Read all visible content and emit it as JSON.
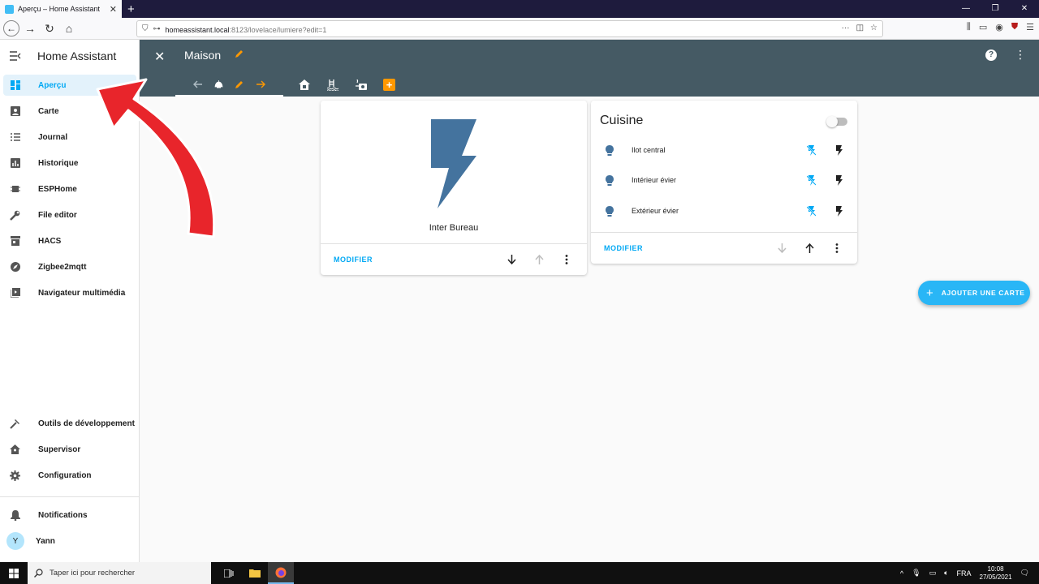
{
  "browser": {
    "tab_title": "Aperçu – Home Assistant",
    "new_tab": "+",
    "url_host": "homeassistant.local",
    "url_path": ":8123/lovelace/lumiere?edit=1"
  },
  "sidebar": {
    "title": "Home Assistant",
    "items": [
      {
        "label": "Aperçu",
        "icon": "dashboard-icon"
      },
      {
        "label": "Carte",
        "icon": "map-icon"
      },
      {
        "label": "Journal",
        "icon": "list-icon"
      },
      {
        "label": "Historique",
        "icon": "chart-icon"
      },
      {
        "label": "ESPHome",
        "icon": "chip-icon"
      },
      {
        "label": "File editor",
        "icon": "wrench-icon"
      },
      {
        "label": "HACS",
        "icon": "store-icon"
      },
      {
        "label": "Zigbee2mqtt",
        "icon": "compass-icon"
      },
      {
        "label": "Navigateur multimédia",
        "icon": "media-icon"
      }
    ],
    "bottom_items": [
      {
        "label": "Outils de développement",
        "icon": "hammer-icon"
      },
      {
        "label": "Supervisor",
        "icon": "home-assistant-icon"
      },
      {
        "label": "Configuration",
        "icon": "cog-icon"
      }
    ],
    "notifications_label": "Notifications",
    "user_name": "Yann",
    "user_initial": "Y"
  },
  "header": {
    "title": "Maison"
  },
  "cards": {
    "button": {
      "name": "Inter Bureau",
      "footer_label": "MODIFIER"
    },
    "entities": {
      "title": "Cuisine",
      "rows": [
        {
          "name": "Ilot central"
        },
        {
          "name": "Intérieur évier"
        },
        {
          "name": "Extérieur évier"
        }
      ],
      "footer_label": "MODIFIER"
    }
  },
  "fab": {
    "label": "AJOUTER UNE CARTE"
  },
  "taskbar": {
    "search_placeholder": "Taper ici pour rechercher",
    "lang": "FRA",
    "time": "10:08",
    "date": "27/05/2021"
  },
  "colors": {
    "header": "#455a64",
    "accent": "#03a9f4",
    "bolt": "#44739e",
    "arrow": "#e8252b",
    "orange": "#ff9800"
  }
}
